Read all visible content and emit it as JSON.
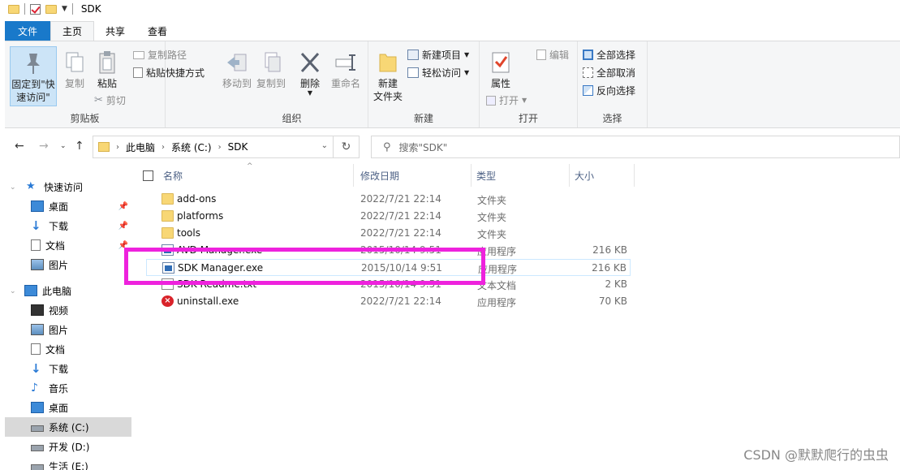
{
  "window": {
    "title": "SDK"
  },
  "tabs": [
    {
      "label": "文件"
    },
    {
      "label": "主页"
    },
    {
      "label": "共享"
    },
    {
      "label": "查看"
    }
  ],
  "ribbon": {
    "clipboard": {
      "label": "剪贴板",
      "pin": "固定到\"快\n速访问\"",
      "copy": "复制",
      "paste": "粘贴",
      "copy_path": "复制路径",
      "paste_shortcut": "粘贴快捷方式",
      "cut": "剪切"
    },
    "organize": {
      "label": "组织",
      "move_to": "移动到",
      "copy_to": "复制到",
      "delete": "删除",
      "rename": "重命名"
    },
    "new": {
      "label": "新建",
      "new_folder": "新建\n文件夹",
      "new_item": "新建项目",
      "easy_access": "轻松访问"
    },
    "open": {
      "label": "打开",
      "properties": "属性",
      "open": "打开",
      "edit": "编辑"
    },
    "select": {
      "label": "选择",
      "select_all": "全部选择",
      "select_none": "全部取消",
      "invert": "反向选择"
    }
  },
  "address": {
    "crumbs": [
      "此电脑",
      "系统 (C:)",
      "SDK"
    ],
    "search_placeholder": "搜索\"SDK\""
  },
  "sidebar": {
    "quick_access": "快速访问",
    "quick_items": [
      "桌面",
      "下载",
      "文档",
      "图片"
    ],
    "this_pc": "此电脑",
    "pc_items": [
      "视频",
      "图片",
      "文档",
      "下载",
      "音乐",
      "桌面",
      "系统 (C:)",
      "开发 (D:)",
      "生活 (E:)"
    ]
  },
  "columns": {
    "name": "名称",
    "date": "修改日期",
    "type": "类型",
    "size": "大小"
  },
  "files": [
    {
      "name": "add-ons",
      "date": "2022/7/21 22:14",
      "type": "文件夹",
      "size": "",
      "kind": "folder"
    },
    {
      "name": "platforms",
      "date": "2022/7/21 22:14",
      "type": "文件夹",
      "size": "",
      "kind": "folder"
    },
    {
      "name": "tools",
      "date": "2022/7/21 22:14",
      "type": "文件夹",
      "size": "",
      "kind": "folder"
    },
    {
      "name": "AVD Manager.exe",
      "date": "2015/10/14 9:51",
      "type": "应用程序",
      "size": "216 KB",
      "kind": "exe"
    },
    {
      "name": "SDK Manager.exe",
      "date": "2015/10/14 9:51",
      "type": "应用程序",
      "size": "216 KB",
      "kind": "exe"
    },
    {
      "name": "SDK Readme.txt",
      "date": "2015/10/14 9:51",
      "type": "文本文档",
      "size": "2 KB",
      "kind": "txt"
    },
    {
      "name": "uninstall.exe",
      "date": "2022/7/21 22:14",
      "type": "应用程序",
      "size": "70 KB",
      "kind": "uninstall"
    }
  ],
  "watermark": "CSDN @默默爬行的虫虫",
  "colors": {
    "file_tab": "#1979ca",
    "highlight_box": "#ee22dd",
    "folder": "#f8d775"
  }
}
